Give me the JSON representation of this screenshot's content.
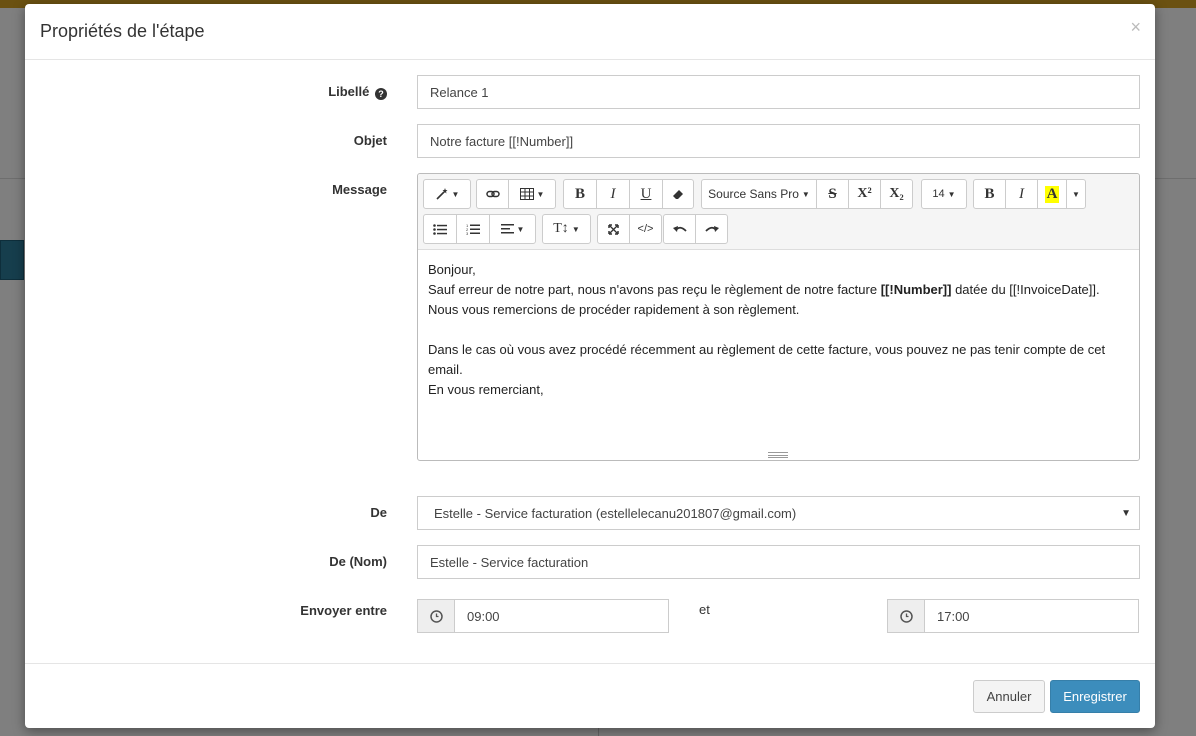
{
  "modal": {
    "title": "Propriétés de l'étape",
    "close": "×"
  },
  "form": {
    "libelle": {
      "label": "Libellé",
      "value": "Relance 1"
    },
    "objet": {
      "label": "Objet",
      "value": "Notre facture [[!Number]]"
    },
    "message": {
      "label": "Message",
      "toolbar": {
        "font_family": "Source Sans Pro",
        "font_size": "14",
        "bold": "B",
        "italic": "I",
        "underline": "U",
        "superscript": "X²",
        "subscript": "X₂",
        "code": "</>"
      },
      "content": {
        "line1": "Bonjour,",
        "line2_pre": "Sauf erreur de notre part, nous n'avons pas reçu le règlement de notre facture ",
        "line2_bold": "[[!Number]]",
        "line2_post": " datée du [[!InvoiceDate]].",
        "line3": "Nous vous remercions de procéder rapidement à son règlement.",
        "line4": "Dans le cas où vous avez procédé récemment au règlement de cette facture, vous pouvez ne pas tenir compte de cet email.",
        "line5": "En vous remerciant,"
      }
    },
    "de": {
      "label": "De",
      "value": "Estelle - Service facturation (estellelecanu201807@gmail.com)"
    },
    "de_nom": {
      "label": "De (Nom)",
      "value": "Estelle -  Service facturation"
    },
    "envoyer": {
      "label": "Envoyer entre",
      "from": "09:00",
      "and": "et",
      "to": "17:00"
    }
  },
  "footer": {
    "cancel": "Annuler",
    "save": "Enregistrer"
  },
  "colors": {
    "primary": "#3c8dbc",
    "topbar": "#d6a223",
    "highlight": "#ffff00"
  }
}
